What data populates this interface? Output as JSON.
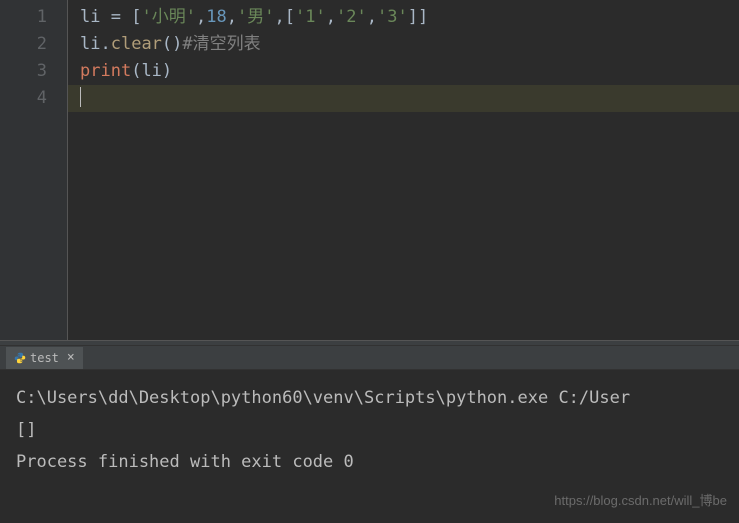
{
  "editor": {
    "line_numbers": [
      "1",
      "2",
      "3",
      "4"
    ],
    "lines": {
      "l1": {
        "var": "li",
        "op": " = ",
        "lb": "[",
        "s1q1": "'",
        "s1": "小明",
        "s1q2": "'",
        "c1": ",",
        "num": "18",
        "c2": ",",
        "s2q1": "'",
        "s2": "男",
        "s2q2": "'",
        "c3": ",",
        "ilb": "[",
        "is1q1": "'",
        "is1": "1",
        "is1q2": "'",
        "ic1": ",",
        "is2q1": "'",
        "is2": "2",
        "is2q2": "'",
        "ic2": ",",
        "is3q1": "'",
        "is3": "3",
        "is3q2": "'",
        "irb": "]",
        "rb": "]"
      },
      "l2": {
        "var": "li",
        "dot": ".",
        "method": "clear",
        "lp": "(",
        "rp": ")",
        "comment": "#清空列表"
      },
      "l3": {
        "builtin": "print",
        "lp": "(",
        "arg": "li",
        "rp": ")"
      }
    }
  },
  "tab": {
    "label": "test"
  },
  "console": {
    "line1": "C:\\Users\\dd\\Desktop\\python60\\venv\\Scripts\\python.exe C:/User",
    "line2": "[]",
    "line3": "",
    "line4": "Process finished with exit code 0"
  },
  "watermark": "https://blog.csdn.net/will_博be"
}
